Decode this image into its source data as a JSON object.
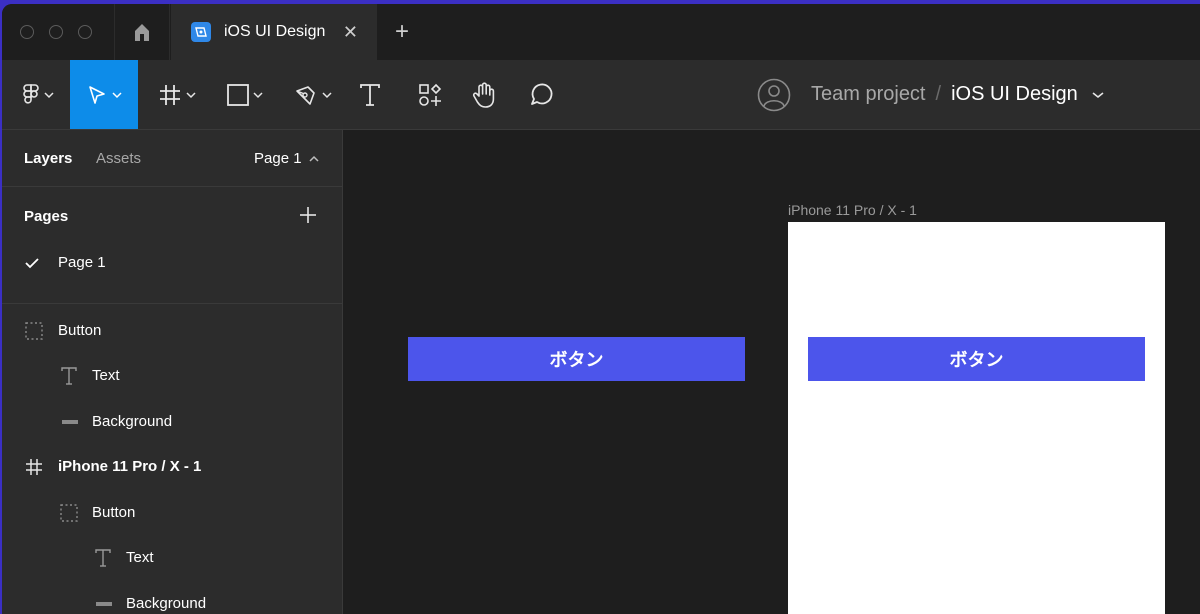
{
  "tabbar": {
    "file_tab_title": "iOS UI Design",
    "close_glyph": "✕",
    "new_tab_glyph": "+"
  },
  "toolbar": {
    "team": "Team project",
    "separator": "/",
    "file_name": "iOS UI Design",
    "active_tool": "move-tool",
    "accent": "#0d8ce9"
  },
  "panel": {
    "tab_layers": "Layers",
    "tab_assets": "Assets",
    "page_selector": "Page 1",
    "pages_title": "Pages",
    "current_page": "Page 1",
    "layers": [
      {
        "label": "Button",
        "icon": "component-dashed-icon"
      },
      {
        "label": "Text",
        "icon": "text-icon"
      },
      {
        "label": "Background",
        "icon": "rectangle-line-icon"
      },
      {
        "label": "iPhone 11 Pro / X - 1",
        "icon": "frame-icon"
      },
      {
        "label": "Button",
        "icon": "component-dashed-icon"
      },
      {
        "label": "Text",
        "icon": "text-icon"
      },
      {
        "label": "Background",
        "icon": "rectangle-line-icon"
      }
    ]
  },
  "canvas": {
    "button_label": "ボタン",
    "frame_label": "iPhone 11 Pro / X - 1",
    "frame_button_label": "ボタン",
    "button_color": "#4c55eb"
  }
}
